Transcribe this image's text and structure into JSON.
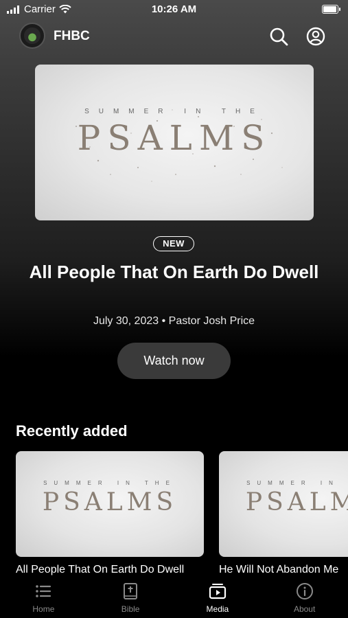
{
  "status_bar": {
    "carrier": "Carrier",
    "time": "10:26 AM"
  },
  "header": {
    "brand": "FHBC",
    "icons": [
      "search-icon",
      "account-icon"
    ]
  },
  "featured": {
    "artwork": {
      "top_line": "SUMMER IN THE",
      "word": "PSALMS"
    },
    "badge": "NEW",
    "title": "All People That On Earth Do Dwell",
    "date": "July 30, 2023",
    "separator": "•",
    "speaker": "Pastor Josh Price",
    "button": "Watch now"
  },
  "recently_added": {
    "heading": "Recently added",
    "items": [
      {
        "title": "All People That On Earth Do Dwell",
        "artwork_top": "SUMMER IN THE",
        "artwork_word": "PSALMS"
      },
      {
        "title": "He Will Not Abandon Me",
        "artwork_top": "SUMMER IN THE",
        "artwork_word": "PSALMS"
      }
    ]
  },
  "tab_bar": {
    "items": [
      {
        "label": "Home",
        "icon": "list-icon",
        "active": false
      },
      {
        "label": "Bible",
        "icon": "bible-icon",
        "active": false
      },
      {
        "label": "Media",
        "icon": "media-play-icon",
        "active": true
      },
      {
        "label": "About",
        "icon": "info-icon",
        "active": false
      }
    ]
  },
  "colors": {
    "background_top": "#4a4a4a",
    "background_bottom": "#000000",
    "button_bg": "#3a3a3a",
    "tab_inactive": "#8a8a8a",
    "tab_active": "#ffffff"
  }
}
